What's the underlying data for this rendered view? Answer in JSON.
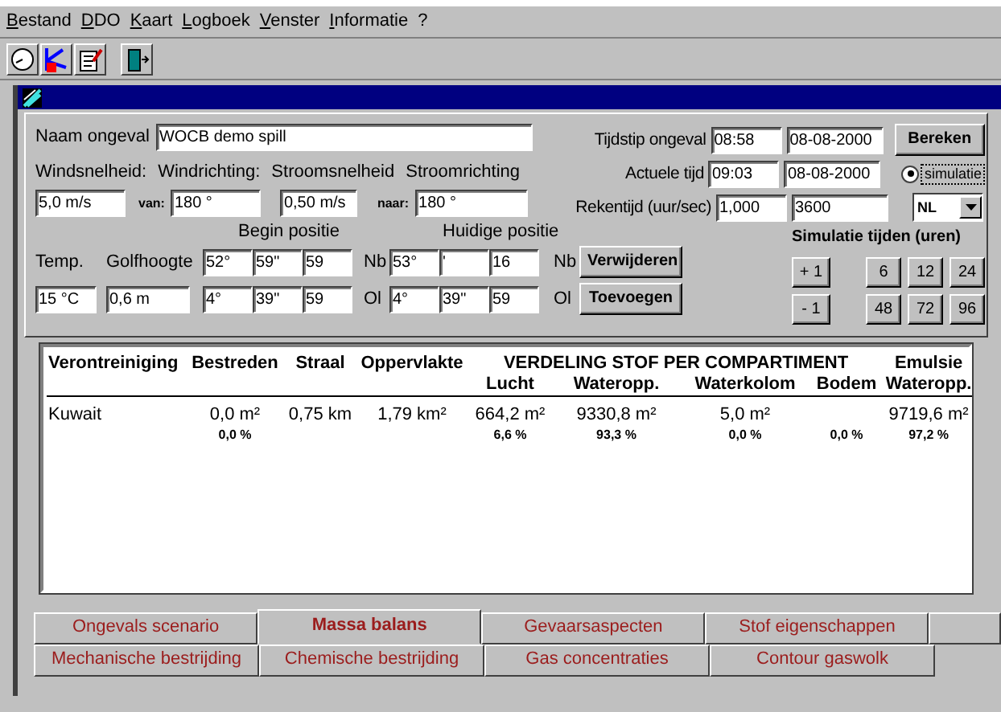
{
  "menu": [
    {
      "key": "B",
      "rest": "estand"
    },
    {
      "key": "D",
      "rest": "DO"
    },
    {
      "key": "K",
      "rest": "aart"
    },
    {
      "key": "L",
      "rest": "ogboek"
    },
    {
      "key": "V",
      "rest": "enster"
    },
    {
      "key": "I",
      "rest": "nformatie"
    },
    {
      "rest": "?"
    }
  ],
  "incident": {
    "label": "Naam ongeval",
    "value": "WOCB demo spill"
  },
  "conditions": {
    "labels": [
      "Windsnelheid:",
      "Windrichting:",
      "Stroomsnelheid",
      "Stroomrichting"
    ],
    "wind_speed": "5,0 m/s",
    "wind_from_label": "van:",
    "wind_direction": "180 °",
    "current_speed": "0,50 m/s",
    "current_to_label": "naar:",
    "current_direction": "180 °"
  },
  "position": {
    "begin_label": "Begin positie",
    "current_label": "Huidige positie",
    "temp_label": "Temp.",
    "wave_label": "Golfhoogte",
    "temp": "15 °C",
    "wave": "0,6 m",
    "rows": [
      {
        "begin": [
          "52°",
          "59\"",
          "59"
        ],
        "prefix": "Nb",
        "current": [
          "53°",
          "'",
          "16"
        ],
        "suffix": "Nb"
      },
      {
        "begin": [
          "4°",
          "39\"",
          "59"
        ],
        "prefix": "Ol",
        "current": [
          "4°",
          "39\"",
          "59"
        ],
        "suffix": "Ol"
      }
    ],
    "buttons": [
      "Verwijderen",
      "Toevoegen"
    ]
  },
  "times": [
    {
      "label": "Tijdstip ongeval",
      "value_1": "08:58",
      "value_2": "08-08-2000"
    },
    {
      "label": "Actuele tijd",
      "value_1": "09:03",
      "value_2": "08-08-2000"
    },
    {
      "label": "Rekentijd (uur/sec)",
      "value_1": "1,000",
      "value_2": "3600"
    }
  ],
  "calculate_button": "Bereken",
  "simulation": {
    "label": "simulatie",
    "checked": true
  },
  "language": "NL",
  "sim_times": {
    "title": "Simulatie tijden (uren)",
    "rows": [
      [
        "+ 1",
        "6",
        "12",
        "24"
      ],
      [
        "- 1",
        "48",
        "72",
        "96"
      ]
    ]
  },
  "table": {
    "columns": [
      "Verontreiniging",
      "Bestreden",
      "Straal",
      "Oppervlakte"
    ],
    "group": "VERDELING STOF PER COMPARTIMENT",
    "subcolumns": [
      "Lucht",
      "Wateropp.",
      "Waterkolom",
      "Bodem"
    ],
    "last_column": [
      "Emulsie",
      "Wateropp."
    ],
    "rows": [
      {
        "cells": [
          {
            "value": "Kuwait"
          },
          {
            "value": "0,0 m²",
            "percent": "0,0 %"
          },
          {
            "value": "0,75 km"
          },
          {
            "value": "1,79 km²"
          },
          {
            "value": "664,2 m²",
            "percent": "6,6 %"
          },
          {
            "value": "9330,8 m²",
            "percent": "93,3 %"
          },
          {
            "value": "5,0 m²",
            "percent": "0,0 %"
          },
          {
            "percent": "0,0 %"
          },
          {
            "value": "9719,6 m²",
            "percent": "97,2 %"
          }
        ]
      }
    ]
  },
  "tabs": [
    [
      {
        "label": "Ongevals scenario",
        "selected": false
      },
      {
        "label": "Massa balans",
        "selected": true
      },
      {
        "label": "Gevaarsaspecten",
        "selected": false
      },
      {
        "label": "Stof eigenschappen",
        "selected": false
      }
    ],
    [
      {
        "label": "Mechanische bestrijding",
        "selected": false
      },
      {
        "label": "Chemische bestrijding",
        "selected": false
      },
      {
        "label": "Gas concentraties",
        "selected": false
      },
      {
        "label": "Contour gaswolk",
        "selected": false
      }
    ]
  ]
}
